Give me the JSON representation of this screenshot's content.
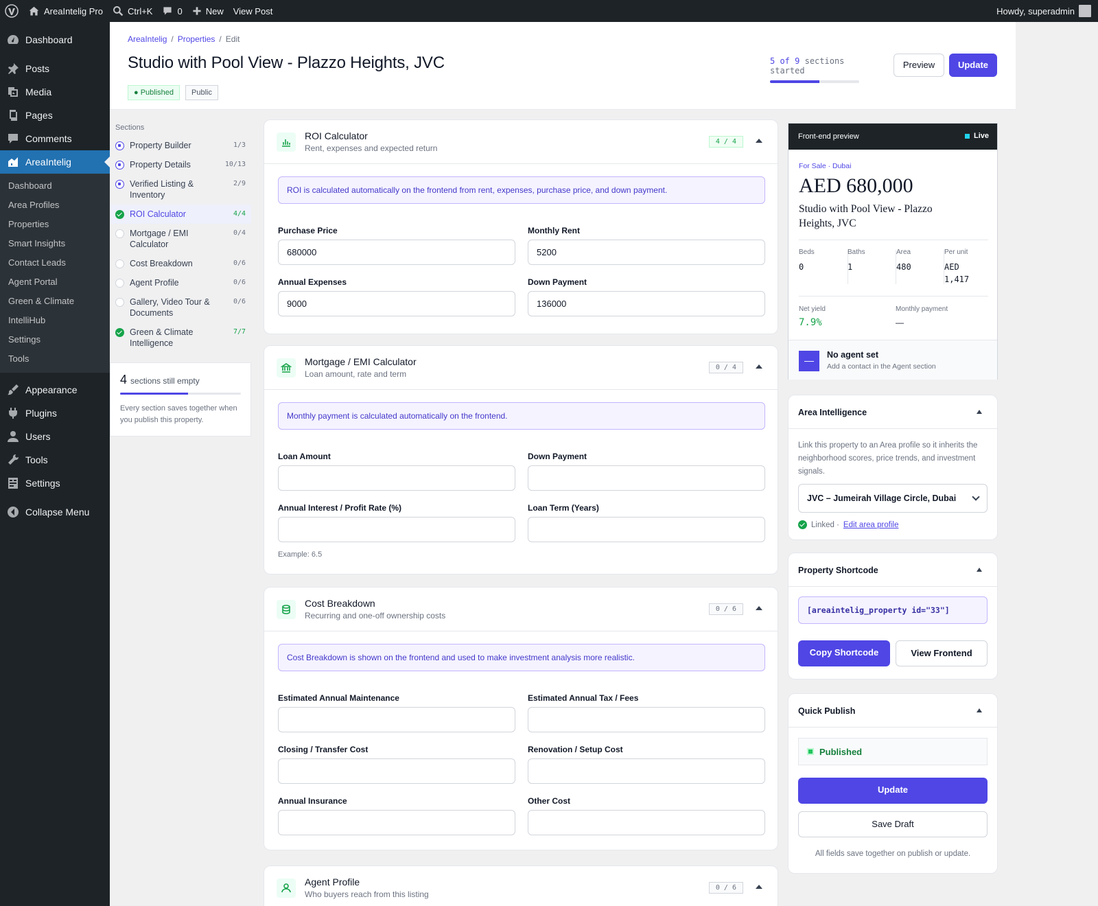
{
  "admin_bar": {
    "site_name": "AreaIntelig Pro",
    "search_shortcut": "Ctrl+K",
    "comments_count": "0",
    "new_label": "New",
    "view_post": "View Post",
    "greeting": "Howdy, superadmin"
  },
  "admin_menu": {
    "items": [
      {
        "label": "Dashboard",
        "icon": "dashboard-icon"
      },
      {
        "label": "Posts",
        "icon": "pin-icon"
      },
      {
        "label": "Media",
        "icon": "media-icon"
      },
      {
        "label": "Pages",
        "icon": "pages-icon"
      },
      {
        "label": "Comments",
        "icon": "comment-icon"
      },
      {
        "label": "AreaIntelig",
        "icon": "areaintelig-icon"
      },
      {
        "label": "Appearance",
        "icon": "brush-icon"
      },
      {
        "label": "Plugins",
        "icon": "plugin-icon"
      },
      {
        "label": "Users",
        "icon": "users-icon"
      },
      {
        "label": "Tools",
        "icon": "wrench-icon"
      },
      {
        "label": "Settings",
        "icon": "settings-icon"
      },
      {
        "label": "Collapse Menu",
        "icon": "collapse-icon"
      }
    ],
    "submenu": [
      "Dashboard",
      "Area Profiles",
      "Properties",
      "Smart Insights",
      "Contact Leads",
      "Agent Portal",
      "Green & Climate",
      "IntelliHub",
      "Settings",
      "Tools"
    ]
  },
  "header": {
    "breadcrumb": [
      "AreaIntelig",
      "Properties",
      "Edit"
    ],
    "separator": "/",
    "title": "Studio with Pool View - Plazzo Heights, JVC",
    "badge_status": "Published",
    "badge_visibility": "Public",
    "progress_started": "5 of 9",
    "progress_suffix": "sections started",
    "progress_fraction": 0.55,
    "preview_label": "Preview",
    "update_label": "Update"
  },
  "sections_nav": {
    "title": "Sections",
    "items": [
      {
        "label": "Property Builder",
        "count": "1/3",
        "state": "partial"
      },
      {
        "label": "Property Details",
        "count": "10/13",
        "state": "partial"
      },
      {
        "label": "Verified Listing & Inventory",
        "count": "2/9",
        "state": "partial"
      },
      {
        "label": "ROI Calculator",
        "count": "4/4",
        "state": "done"
      },
      {
        "label": "Mortgage / EMI Calculator",
        "count": "0/4",
        "state": "empty"
      },
      {
        "label": "Cost Breakdown",
        "count": "0/6",
        "state": "empty"
      },
      {
        "label": "Agent Profile",
        "count": "0/6",
        "state": "empty"
      },
      {
        "label": "Gallery, Video Tour & Documents",
        "count": "0/6",
        "state": "empty"
      },
      {
        "label": "Green & Climate Intelligence",
        "count": "7/7",
        "state": "done"
      }
    ],
    "empty_count": "4",
    "empty_label": "sections still empty",
    "empty_fraction": 0.56,
    "empty_note": "Every section saves together when you publish this property."
  },
  "roi": {
    "title": "ROI Calculator",
    "subtitle": "Rent, expenses and expected return",
    "count": "4 / 4",
    "note": "ROI is calculated automatically on the frontend from rent, expenses, purchase price, and down payment.",
    "fields": [
      {
        "label": "Purchase Price",
        "value": "680000"
      },
      {
        "label": "Monthly Rent",
        "value": "5200"
      },
      {
        "label": "Annual Expenses",
        "value": "9000"
      },
      {
        "label": "Down Payment",
        "value": "136000"
      }
    ]
  },
  "mortgage": {
    "title": "Mortgage / EMI Calculator",
    "subtitle": "Loan amount, rate and term",
    "count": "0 / 4",
    "note": "Monthly payment is calculated automatically on the frontend.",
    "fields": [
      {
        "label": "Loan Amount",
        "value": ""
      },
      {
        "label": "Down Payment",
        "value": ""
      },
      {
        "label": "Annual Interest / Profit Rate (%)",
        "value": ""
      },
      {
        "label": "Loan Term (Years)",
        "value": ""
      }
    ],
    "hint": "Example: 6.5"
  },
  "cost": {
    "title": "Cost Breakdown",
    "subtitle": "Recurring and one-off ownership costs",
    "count": "0 / 6",
    "note": "Cost Breakdown is shown on the frontend and used to make investment analysis more realistic.",
    "fields": [
      {
        "label": "Estimated Annual Maintenance",
        "value": ""
      },
      {
        "label": "Estimated Annual Tax / Fees",
        "value": ""
      },
      {
        "label": "Closing / Transfer Cost",
        "value": ""
      },
      {
        "label": "Renovation / Setup Cost",
        "value": ""
      },
      {
        "label": "Annual Insurance",
        "value": ""
      },
      {
        "label": "Other Cost",
        "value": ""
      }
    ]
  },
  "agent": {
    "title": "Agent Profile",
    "subtitle": "Who buyers reach from this listing",
    "count": "0 / 6"
  },
  "preview": {
    "header": "Front-end preview",
    "live": "Live",
    "tag": "For Sale · Dubai",
    "price": "AED 680,000",
    "title": "Studio with Pool View - Plazzo Heights, JVC",
    "stats": [
      {
        "k": "Beds",
        "v": "0"
      },
      {
        "k": "Baths",
        "v": "1"
      },
      {
        "k": "Area",
        "v": "480"
      },
      {
        "k": "Per unit",
        "v": "AED 1,417"
      }
    ],
    "net_yield_label": "Net yield",
    "net_yield": "7.9%",
    "monthly_label": "Monthly payment",
    "monthly": "—",
    "agent_initial": "—",
    "agent_name": "No agent set",
    "agent_sub": "Add a contact in the Agent section"
  },
  "area_intel": {
    "title": "Area Intelligence",
    "desc": "Link this property to an Area profile so it inherits the neighborhood scores, price trends, and investment signals.",
    "selected": "JVC – Jumeirah Village Circle, Dubai",
    "linked": "Linked ·",
    "edit_link": "Edit area profile"
  },
  "shortcode": {
    "title": "Property Shortcode",
    "code": "[areaintelig_property id=\"33\"]",
    "copy_label": "Copy Shortcode",
    "view_label": "View Frontend"
  },
  "quick_publish": {
    "title": "Quick Publish",
    "status": "Published",
    "update_label": "Update",
    "draft_label": "Save Draft",
    "note": "All fields save together on publish or update."
  },
  "colors": {
    "accent": "#4f46e5",
    "success": "#16a34a",
    "admin_dark": "#1d2327",
    "admin_blue": "#2271b1"
  }
}
